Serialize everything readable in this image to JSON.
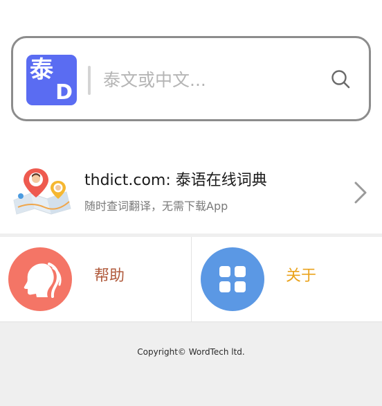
{
  "search": {
    "logo_main": "泰",
    "logo_sub": "D",
    "placeholder": "泰文或中文...",
    "value": ""
  },
  "promo": {
    "title": "thdict.com: 泰语在线词典",
    "subtitle": "随时查词翻译，无需下载App"
  },
  "grid": {
    "help_label": "帮助",
    "about_label": "关于"
  },
  "footer": {
    "copyright": "Copyright© WordTech ltd."
  },
  "colors": {
    "logo_bg": "#5a6cf2",
    "help_circle": "#f47566",
    "help_text": "#b05a3c",
    "about_circle": "#5b98e4",
    "about_text": "#eaa31c",
    "footer_bg": "#efefef"
  },
  "icons": {
    "search": "search-icon",
    "map": "map-pin-icon",
    "chevron": "chevron-right-icon",
    "help": "head-silhouette-icon",
    "about": "grid-apps-icon"
  }
}
